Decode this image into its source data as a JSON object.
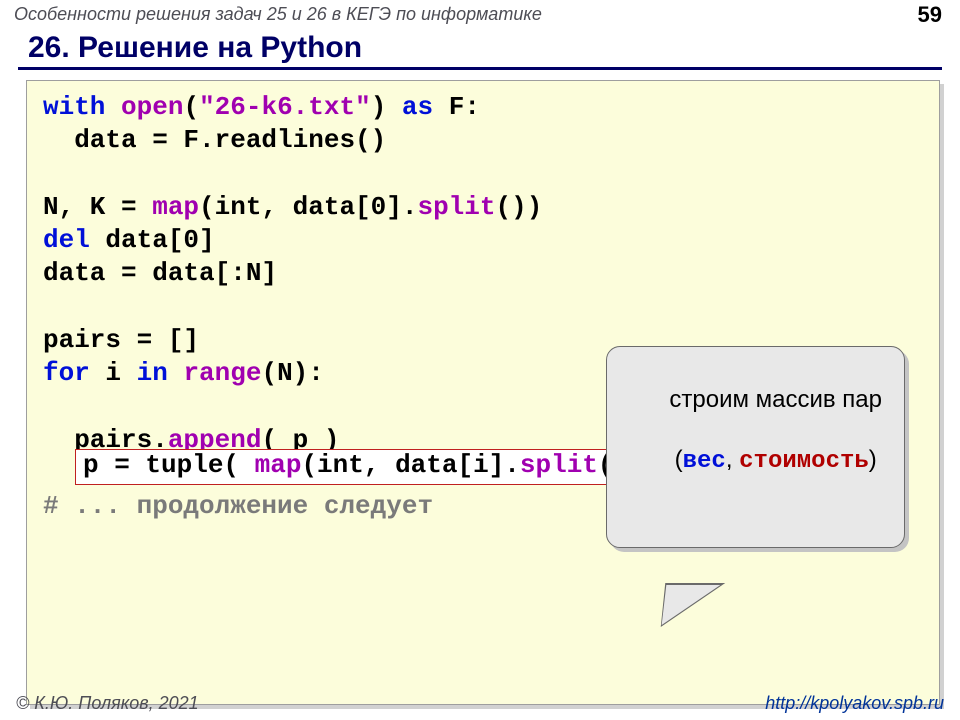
{
  "header": {
    "subject": "Особенности решения задач 25 и 26 в КЕГЭ по информатике",
    "page_number": "59",
    "title": "26. Решение на Python"
  },
  "callout": {
    "line1": "строим массив пар",
    "paren_open": "(",
    "word1": "вес",
    "comma": ", ",
    "word2": "стоимость",
    "paren_close": ")"
  },
  "code": {
    "l1_kw1": "with",
    "l1_fn": "open",
    "l1_p1": "(",
    "l1_str": "\"26-k6.txt\"",
    "l1_p2": ")",
    "l1_kw2": "as",
    "l1_id": " F:",
    "l2": "  data = F.readlines()",
    "blank1": " ",
    "l3_a": "N, K = ",
    "l3_fn1": "map",
    "l3_b": "(int, data[0].",
    "l3_fn2": "split",
    "l3_c": "())",
    "l4_kw": "del",
    "l4_b": " data[0]",
    "l5": "data = data[:N]",
    "blank2": " ",
    "l6": "pairs = []",
    "l7_kw": "for",
    "l7_a": " i ",
    "l7_kw2": "in",
    "l7_a2": " ",
    "l7_fn": "range",
    "l7_b": "(N):",
    "l8_pad": "  ",
    "l8_a": "p = tuple( ",
    "l8_fn1": "map",
    "l8_b": "(int, data[i].",
    "l8_fn2": "split",
    "l8_c": "()) )",
    "l9_a": "  pairs.",
    "l9_fn": "append",
    "l9_b": "( p )",
    "blank3": " ",
    "l10": "# ... продолжение следует"
  },
  "footer": {
    "left": "© К.Ю. Поляков, 2021",
    "right": "http://kpolyakov.spb.ru"
  }
}
